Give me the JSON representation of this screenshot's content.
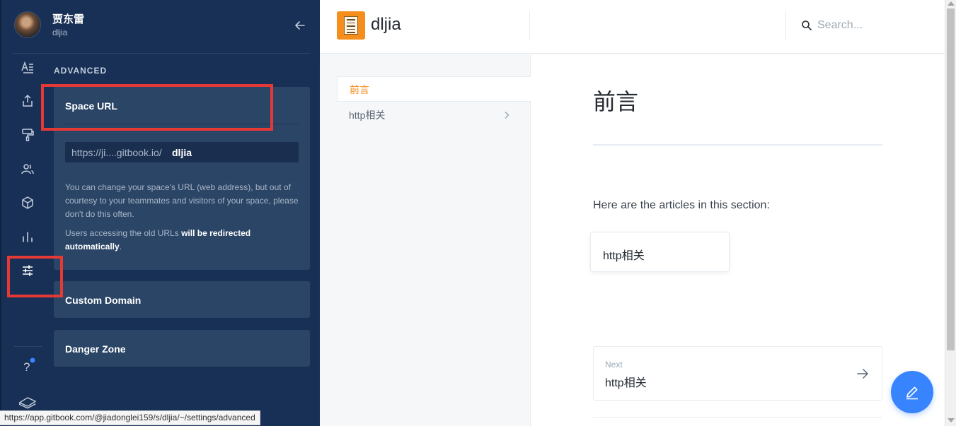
{
  "user": {
    "name": "贾东雷",
    "handle": "dljia"
  },
  "sidebar": {
    "section_label": "ADVANCED",
    "rail_icons": [
      "text-format-icon",
      "share-upload-icon",
      "paint-roller-icon",
      "members-icon",
      "integrations-box-icon",
      "analytics-bar-icon",
      "settings-sliders-icon",
      "help-icon",
      "gitbook-logo-icon"
    ]
  },
  "space_url": {
    "title": "Space URL",
    "prefix": "https://ji....gitbook.io/",
    "value": "dljia",
    "help_text": "You can change your space's URL (web address), but out of courtesy to your teammates and visitors of your space, please don't do this often.",
    "note_prefix": "Users accessing the old URLs ",
    "note_bold": "will be redirected automatically",
    "note_suffix": "."
  },
  "custom_domain": {
    "title": "Custom Domain"
  },
  "danger_zone": {
    "title": "Danger Zone"
  },
  "status_url": "https://app.gitbook.com/@jiadonglei159/s/dljia/~/settings/advanced",
  "space": {
    "name": "dljia",
    "search_placeholder": "Search..."
  },
  "nav": {
    "items": [
      {
        "label": "前言",
        "active": true
      },
      {
        "label": "http相关",
        "active": false
      }
    ]
  },
  "page": {
    "title": "前言",
    "intro": "Here are the articles in this section:",
    "article_link": "http相关",
    "next_label": "Next",
    "next_title": "http相关"
  },
  "colors": {
    "sidebar_bg": "#183055",
    "card_bg": "#2b4566",
    "accent_orange": "#f58e1c",
    "fab_blue": "#3884ff",
    "highlight_red": "#e53935"
  }
}
